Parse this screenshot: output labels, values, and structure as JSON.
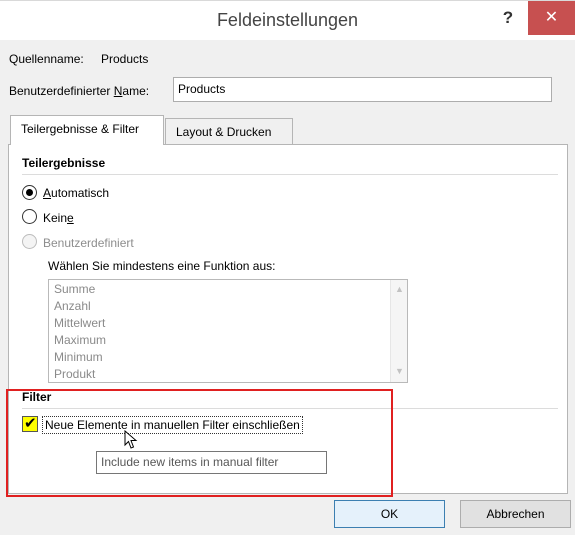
{
  "window": {
    "title": "Feldeinstellungen",
    "help_glyph": "?",
    "close_glyph": "✕",
    "accent_close": "#c75050"
  },
  "source": {
    "label": "Quellenname:",
    "value": "Products"
  },
  "custom_name": {
    "label_before": "Benutzerdefinierter ",
    "label_mnemonic": "N",
    "label_after": "ame:",
    "value": "Products"
  },
  "tabs": [
    {
      "label": "Teilergebnisse & Filter",
      "active": true
    },
    {
      "label": "Layout & Drucken",
      "active": false
    }
  ],
  "subtotals": {
    "section_title": "Teilergebnisse",
    "options": [
      {
        "label_mnemonic": "A",
        "label_rest": "utomatisch",
        "checked": true,
        "disabled": false
      },
      {
        "label_before": "Kein",
        "label_mnemonic": "e",
        "checked": false,
        "disabled": false
      },
      {
        "label": "Benutzerdefiniert",
        "checked": false,
        "disabled": true
      }
    ],
    "function_prompt": "Wählen Sie mindestens eine Funktion aus:",
    "functions": [
      "Summe",
      "Anzahl",
      "Mittelwert",
      "Maximum",
      "Minimum",
      "Produkt"
    ]
  },
  "filter": {
    "section_title": "Filter",
    "checkbox_checked": true,
    "checkbox_label": "Neue Elemente in manuellen Filter einschließen",
    "tooltip": "Include new items in manual filter"
  },
  "buttons": {
    "ok": "OK",
    "cancel": "Abbrechen"
  }
}
